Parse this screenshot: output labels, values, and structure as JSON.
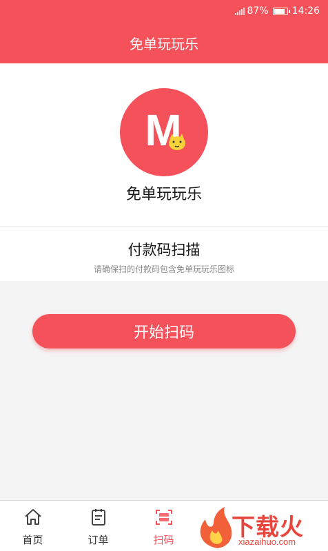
{
  "status_bar": {
    "battery": "87%",
    "time": "14:26"
  },
  "header": {
    "title": "免单玩玩乐"
  },
  "app_card": {
    "logo_letter": "M",
    "app_name": "免单玩玩乐"
  },
  "scan_section": {
    "title": "付款码扫描",
    "hint": "请确保扫的付款码包含免单玩玩乐图标"
  },
  "start_button": {
    "label": "开始扫码"
  },
  "tabs": [
    {
      "label": "首页",
      "icon": "home-icon",
      "active": false
    },
    {
      "label": "订单",
      "icon": "order-icon",
      "active": false
    },
    {
      "label": "扫码",
      "icon": "scan-icon",
      "active": true
    }
  ],
  "watermark": {
    "text": "下载火",
    "sub": "xiazaihuo.com"
  },
  "colors": {
    "primary": "#f5515a",
    "mascot": "#f6d23a"
  }
}
